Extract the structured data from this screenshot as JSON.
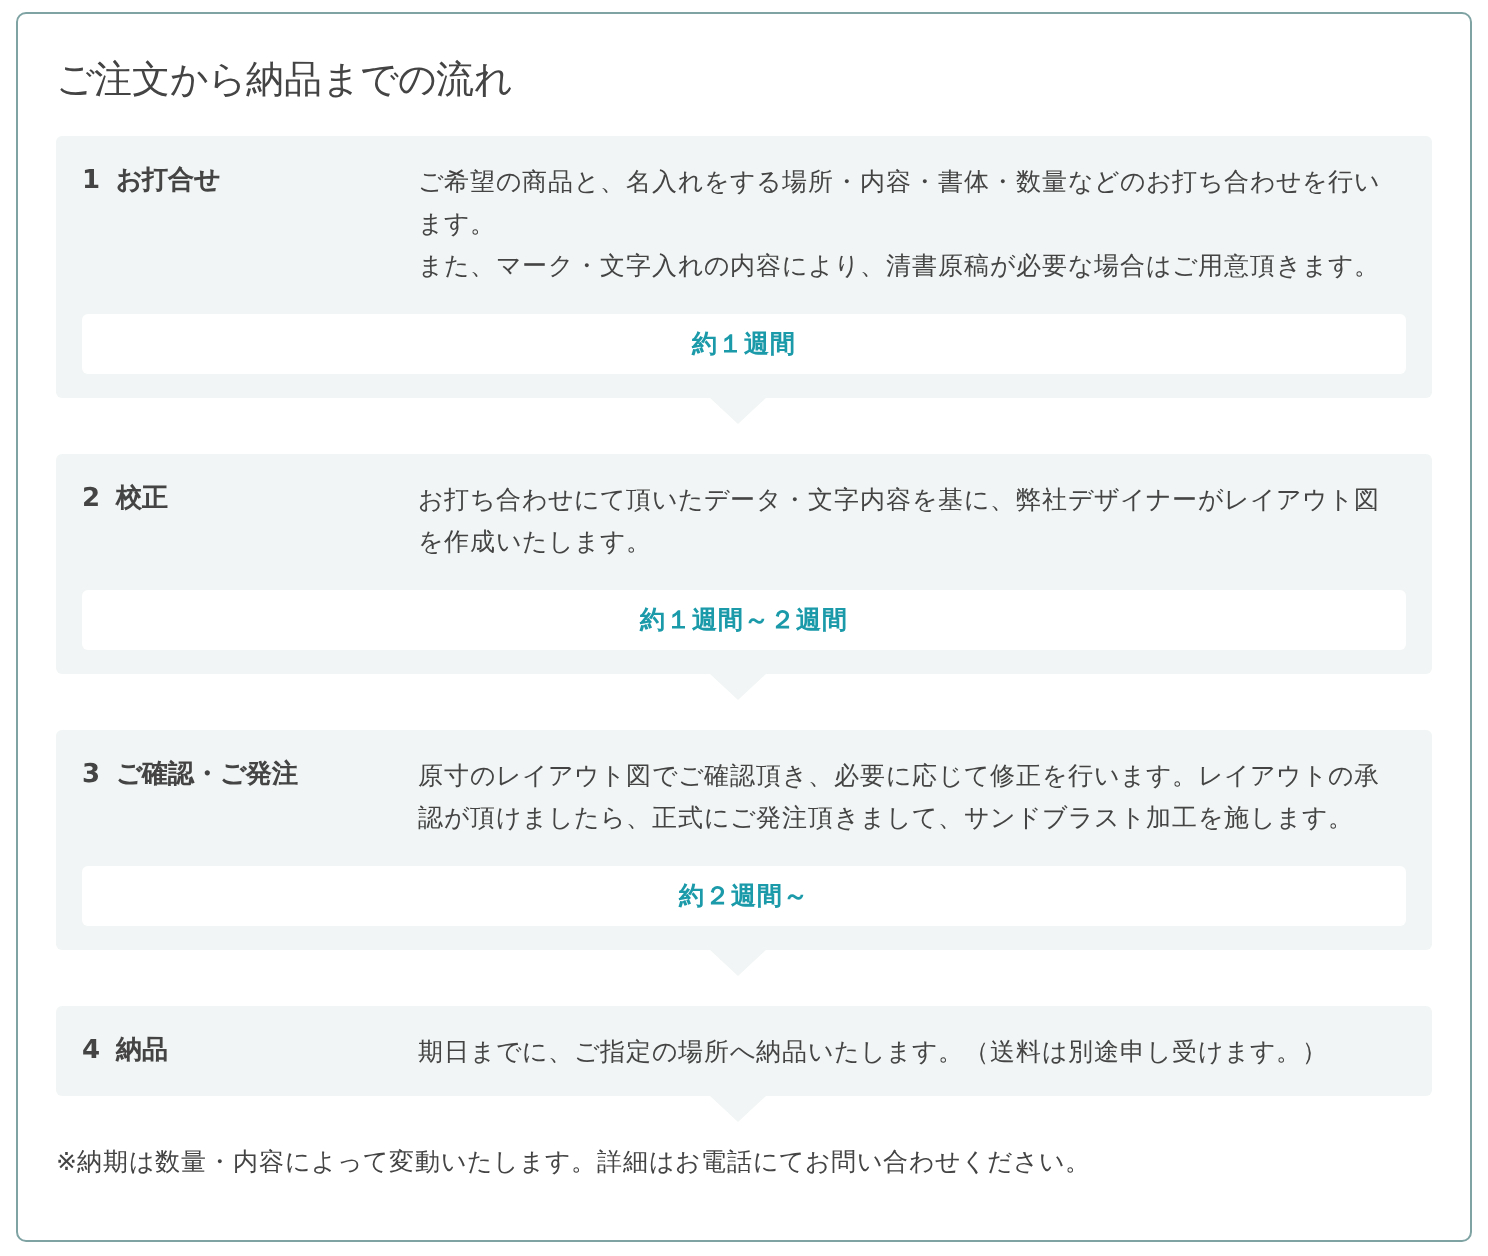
{
  "title": "ご注文から納品までの流れ",
  "steps": [
    {
      "number": "1",
      "name": "お打合せ",
      "description": [
        "ご希望の商品と、名入れをする場所・内容・書体・数量などのお打ち合わせを行います。",
        "また、マーク・文字入れの内容により、清書原稿が必要な場合はご用意頂きます。"
      ],
      "duration": "約１週間"
    },
    {
      "number": "2",
      "name": "校正",
      "description": [
        "お打ち合わせにて頂いたデータ・文字内容を基に、弊社デザイナーがレイアウト図を作成いたします。"
      ],
      "duration": "約１週間～２週間"
    },
    {
      "number": "3",
      "name": "ご確認・ご発注",
      "description": [
        "原寸のレイアウト図でご確認頂き、必要に応じて修正を行います。レイアウトの承認が頂けましたら、正式にご発注頂きまして、サンドブラスト加工を施します。"
      ],
      "duration": "約２週間～"
    },
    {
      "number": "4",
      "name": "納品",
      "description": [
        "期日までに、ご指定の場所へ納品いたします。（送料は別途申し受けます。）"
      ]
    }
  ],
  "note": "※納期は数量・内容によって変動いたします。詳細はお電話にてお問い合わせください。"
}
